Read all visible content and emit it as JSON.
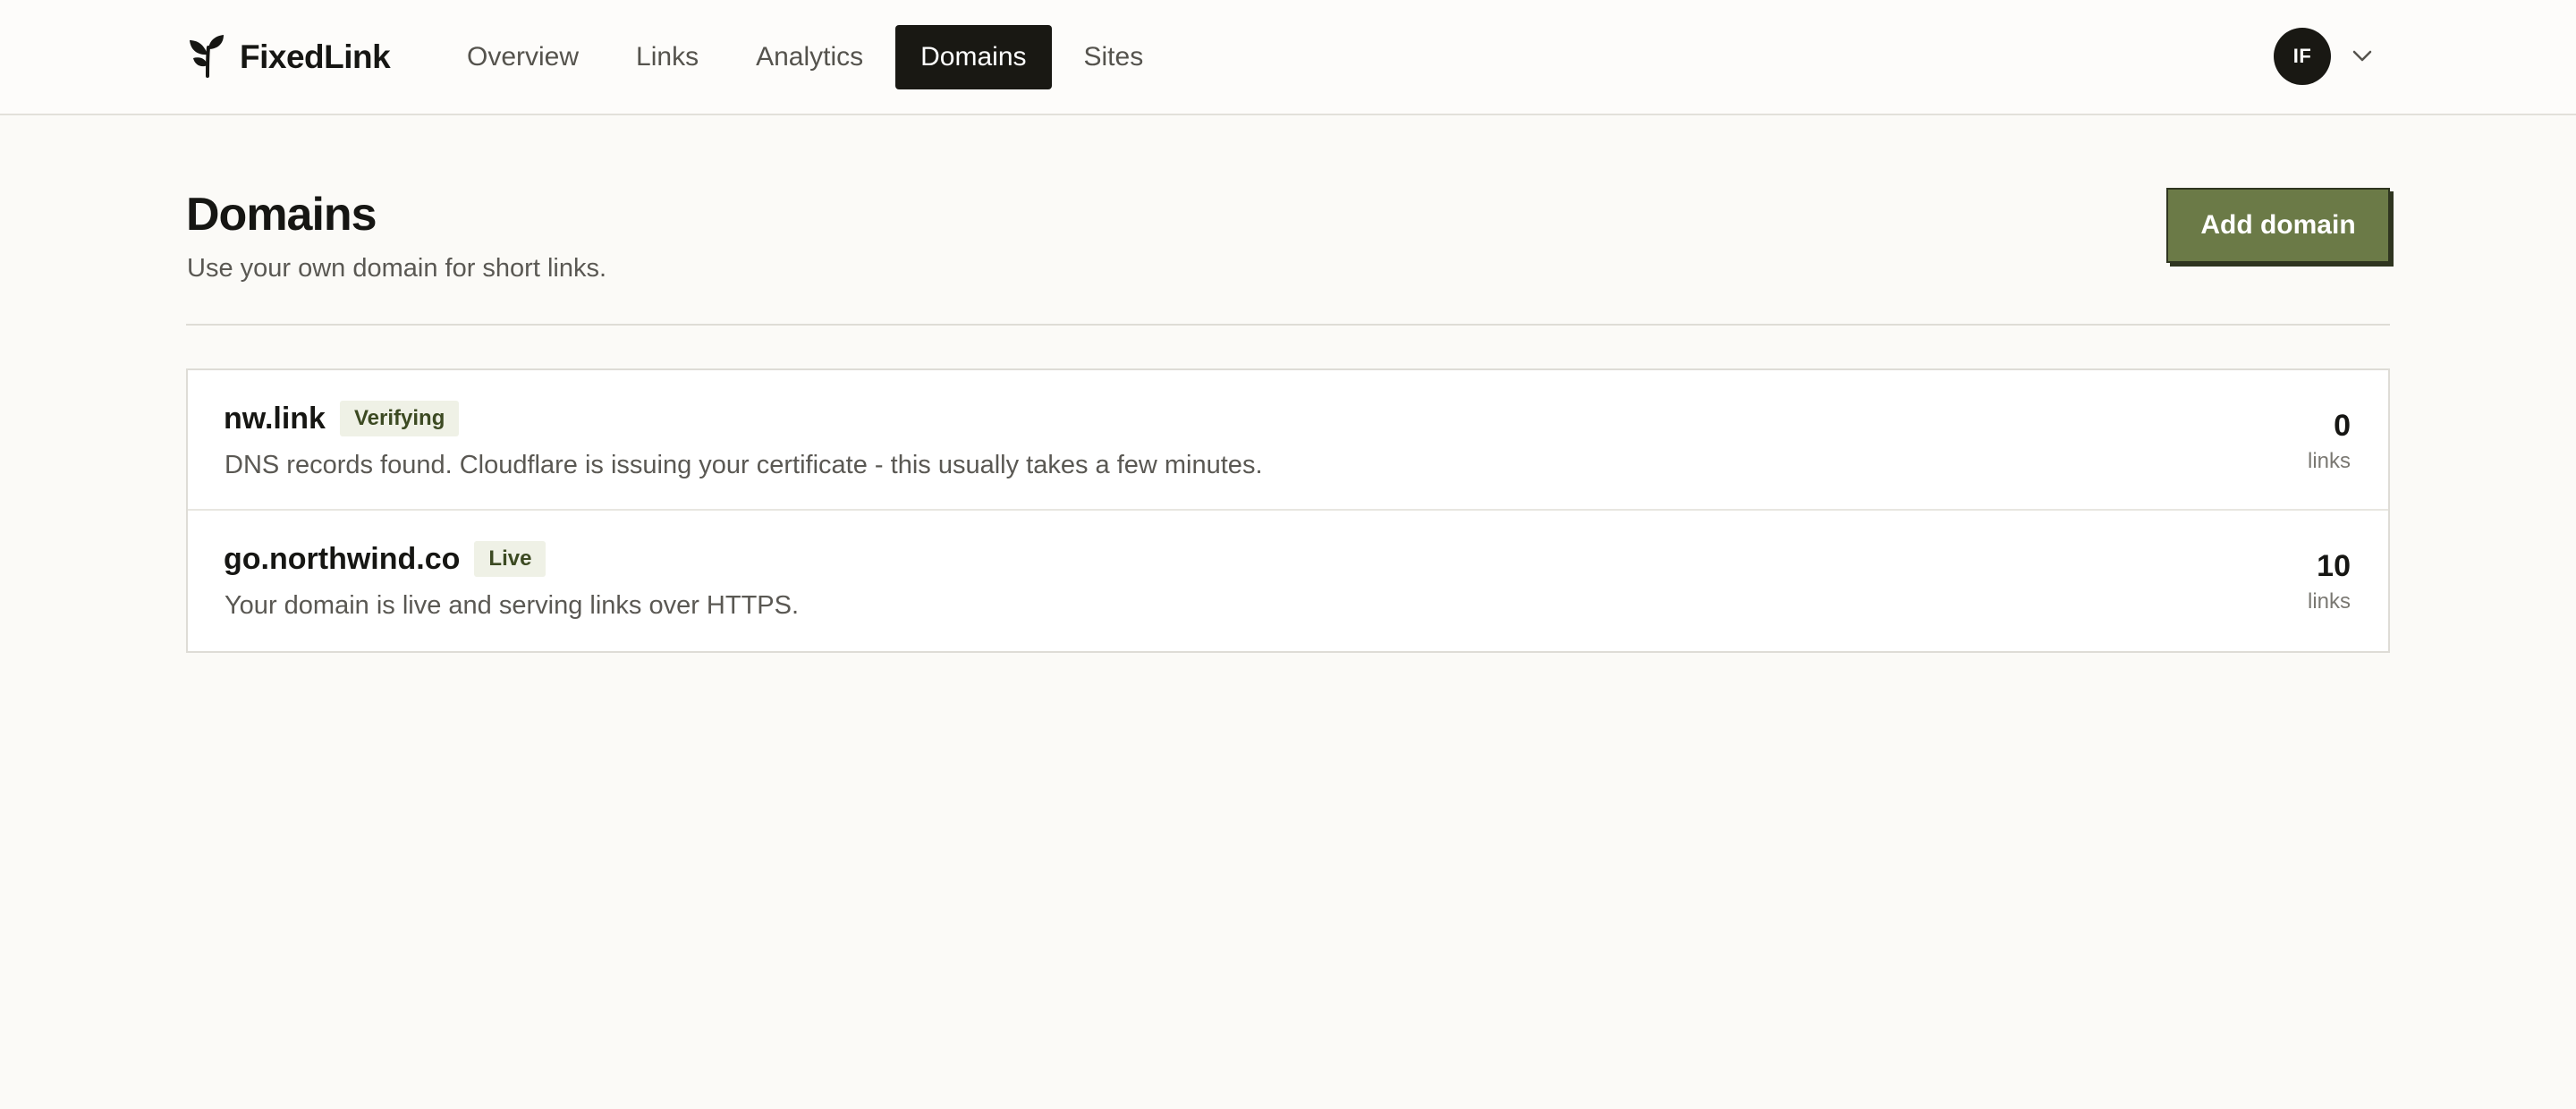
{
  "brand": {
    "name": "FixedLink",
    "icon": "sprout-icon"
  },
  "nav": {
    "items": [
      {
        "label": "Overview",
        "active": false
      },
      {
        "label": "Links",
        "active": false
      },
      {
        "label": "Analytics",
        "active": false
      },
      {
        "label": "Domains",
        "active": true
      },
      {
        "label": "Sites",
        "active": false
      }
    ]
  },
  "user": {
    "initials": "IF",
    "menu_icon": "chevron-down-icon"
  },
  "page": {
    "title": "Domains",
    "subtitle": "Use your own domain for short links.",
    "add_button": "Add domain"
  },
  "domains": [
    {
      "name": "nw.link",
      "status": "Verifying",
      "description": "DNS records found. Cloudflare is issuing your certificate - this usually takes a few minutes.",
      "count": "0",
      "count_label": "links"
    },
    {
      "name": "go.northwind.co",
      "status": "Live",
      "description": "Your domain is live and serving links over HTTPS.",
      "count": "10",
      "count_label": "links"
    }
  ],
  "colors": {
    "accent": "#6b7a47",
    "dark": "#191813",
    "background": "#fbfaf7",
    "badge_bg": "#eff1e6"
  }
}
